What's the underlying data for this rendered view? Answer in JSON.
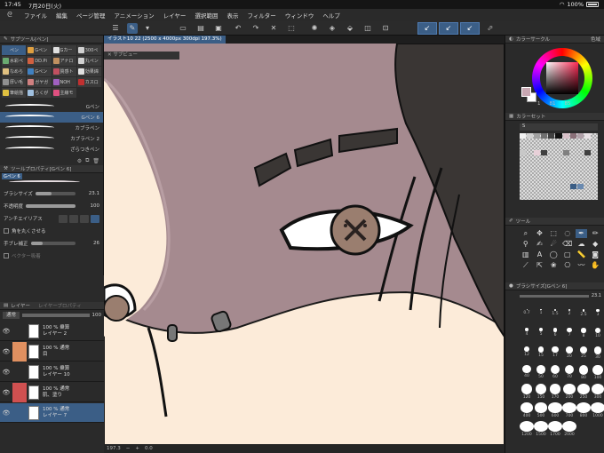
{
  "status": {
    "time": "17:45",
    "date": "7月20日(火)",
    "battery": "100%"
  },
  "menu": [
    "ファイル",
    "編集",
    "ページ管理",
    "アニメーション",
    "レイヤー",
    "選択範囲",
    "表示",
    "フィルター",
    "ウィンドウ",
    "ヘルプ"
  ],
  "subtool": {
    "header": "サブツール[ペン]",
    "items": [
      {
        "label": "ペン",
        "color": "#3b5e86"
      },
      {
        "label": "Gペン",
        "color": "#e0a040"
      },
      {
        "label": "Gカー",
        "color": "#e0e0e0"
      },
      {
        "label": "300ペ",
        "color": "#d0d0d0"
      },
      {
        "label": "水彩ペ",
        "color": "#6aaa70"
      },
      {
        "label": "DD.Pi",
        "color": "#d06040"
      },
      {
        "label": "アナロ",
        "color": "#c09060"
      },
      {
        "label": "丸ペン",
        "color": "#d0d0d0"
      },
      {
        "label": "なめら",
        "color": "#e0c080"
      },
      {
        "label": "Gペン",
        "color": "#4080c0"
      },
      {
        "label": "質感ト",
        "color": "#c05060"
      },
      {
        "label": "効果綿",
        "color": "#e0e0e0"
      },
      {
        "label": "厚い毛",
        "color": "#909090"
      },
      {
        "label": "ガヤガ",
        "color": "#d08080"
      },
      {
        "label": "NOH",
        "color": "#a060c0"
      },
      {
        "label": "カスロ",
        "color": "#c03030"
      },
      {
        "label": "筆絵描",
        "color": "#e0c040"
      },
      {
        "label": "らくが",
        "color": "#a0c0e0"
      },
      {
        "label": "主線モ",
        "color": "#e05080"
      }
    ],
    "brushes": [
      "Gペン",
      "Gペン 6",
      "カブラペン",
      "カブラペン 2",
      "ざらつきペン"
    ]
  },
  "tool_property": {
    "header": "ツールプロパティ[Gペン 6]",
    "brush_name": "Gペン 6",
    "size_label": "ブラシサイズ",
    "size_value": "23.1",
    "opacity_label": "不透明度",
    "opacity_value": "100",
    "aa_label": "アンチエイリアス",
    "corner_label": "角を丸くさせる",
    "stabilize_label": "手ブレ補正",
    "stabilize_value": "26",
    "vector_label": "ベクター吸着"
  },
  "layers": {
    "header": "レイヤー",
    "header2": "レイヤープロパティ",
    "blend": "通常",
    "opacity": "100",
    "rows": [
      {
        "line1": "100 % 乗算",
        "line2": "レイヤー 2",
        "color": ""
      },
      {
        "line1": "100 % 通常",
        "line2": "目",
        "color": "#e09060"
      },
      {
        "line1": "100 % 乗算",
        "line2": "レイヤー 10",
        "color": ""
      },
      {
        "line1": "100 % 通常",
        "line2": "肌、塗り",
        "color": "#d05050"
      },
      {
        "line1": "100 % 通常",
        "line2": "レイヤー 7",
        "color": ""
      }
    ]
  },
  "canvas": {
    "tab_title": "イラスト10 22 (2500 x 4000px 300dpi 197.3%)",
    "tab_sub": "サブビュー",
    "zoom": "197.3",
    "rotation": "0.0"
  },
  "right_panel": {
    "color_wheel_header": "カラーサークル",
    "color_wheel_extra": "色域",
    "color_values": [
      "1",
      "81",
      "85"
    ],
    "color_set_header": "カラーセット",
    "color_set_name": "S",
    "tool_header": "ツール",
    "brush_size_header": "ブラシサイズ[Gペン 6]",
    "brush_size_value": "23.1",
    "sizes": [
      "0.7",
      "1",
      "1.5",
      "2",
      "2.5",
      "3",
      "4",
      "5",
      "6",
      "7",
      "8",
      "10",
      "12",
      "15",
      "17",
      "20",
      "25",
      "30",
      "40",
      "50",
      "60",
      "70",
      "80",
      "100",
      "120",
      "150",
      "170",
      "200",
      "250",
      "300",
      "400",
      "500",
      "600",
      "700",
      "800",
      "1000",
      "1200",
      "1500",
      "1700",
      "2000"
    ]
  },
  "colors": {
    "accent": "#3b5e86",
    "skin": "#fcebd9",
    "hair": "#3a3634",
    "shadow": "#a58a8f",
    "iris": "#9a7e6f"
  }
}
